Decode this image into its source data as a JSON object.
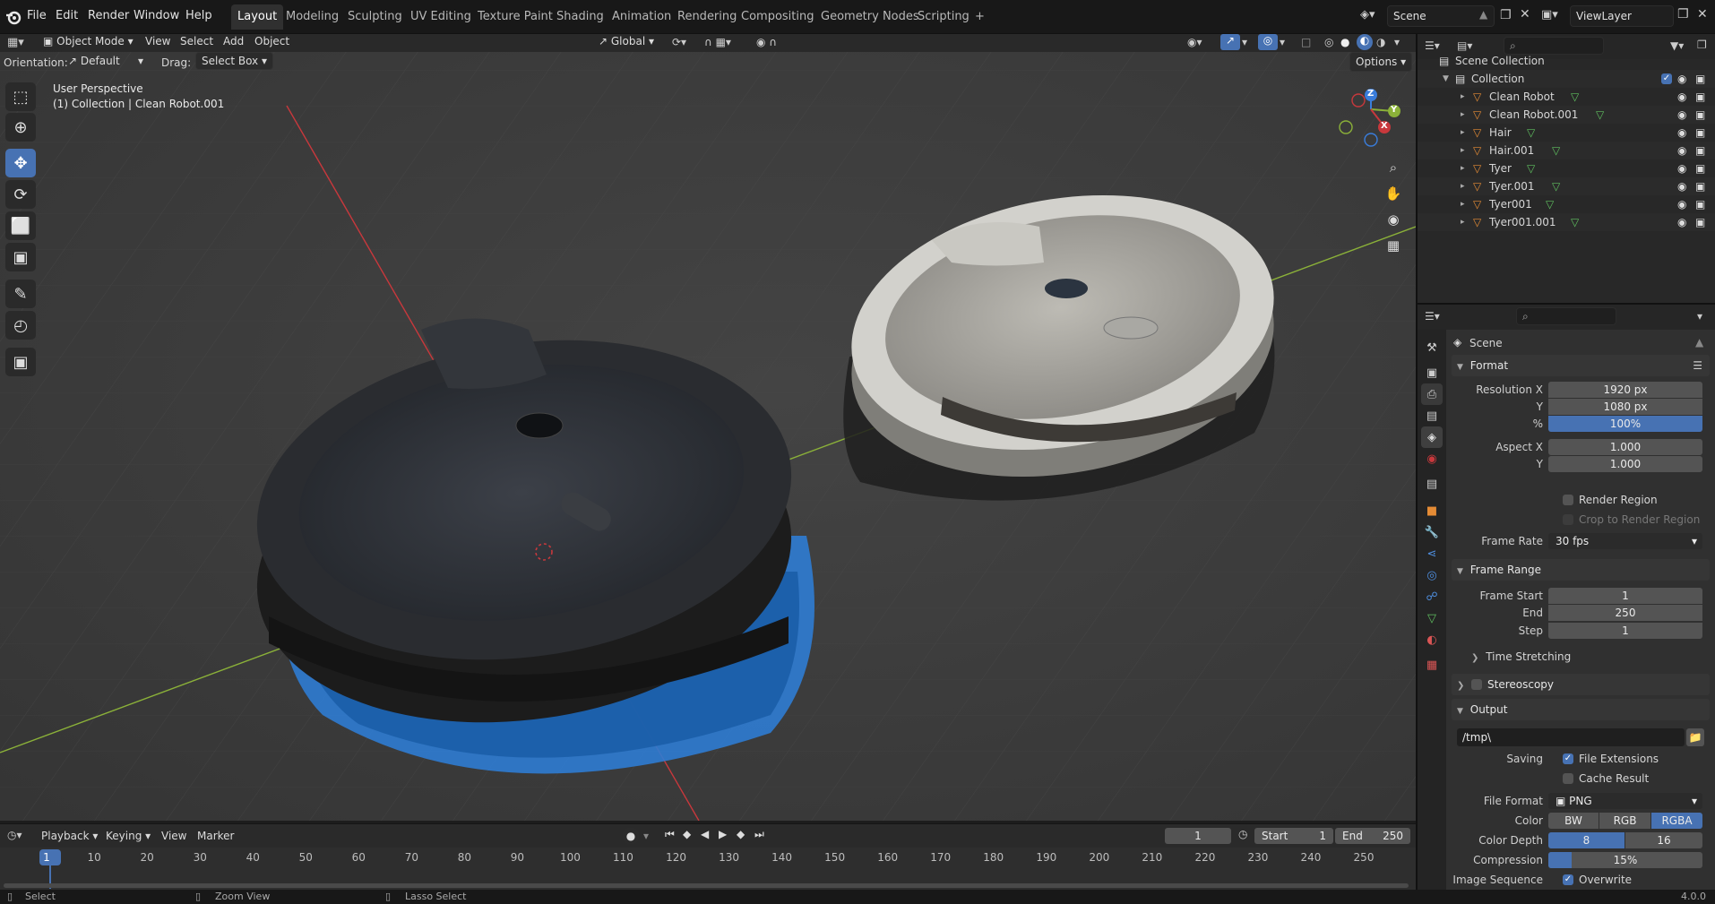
{
  "topbar": {
    "menus": [
      "File",
      "Edit",
      "Render",
      "Window",
      "Help"
    ],
    "workspaces": [
      "Layout",
      "Modeling",
      "Sculpting",
      "UV Editing",
      "Texture Paint",
      "Shading",
      "Animation",
      "Rendering",
      "Compositing",
      "Geometry Nodes",
      "Scripting"
    ],
    "active_workspace": "Layout",
    "add_workspace": "+",
    "scene": "Scene",
    "view_layer": "ViewLayer"
  },
  "viewport_header": {
    "mode": "Object Mode",
    "menus": [
      "View",
      "Select",
      "Add",
      "Object"
    ],
    "transform_orientation": "Global",
    "orientation_label": "Orientation:",
    "orientation_value": "Default",
    "drag_label": "Drag:",
    "drag_value": "Select Box",
    "options": "Options"
  },
  "viewport": {
    "view_name": "User Perspective",
    "view_context": "(1) Collection | Clean Robot.001",
    "gizmo_axes": [
      "Z",
      "Y",
      "X"
    ],
    "colors": {
      "x_axis": "#c8383c",
      "y_axis": "#8bb139",
      "z_axis": "#3a7ddb",
      "selection": "#4772b3"
    }
  },
  "tools": [
    "select-box",
    "cursor",
    "move",
    "rotate",
    "scale",
    "transform",
    "annotate",
    "measure",
    "add-cube"
  ],
  "outliner": {
    "root": "Scene Collection",
    "collection": "Collection",
    "items": [
      {
        "name": "Clean Robot"
      },
      {
        "name": "Clean Robot.001"
      },
      {
        "name": "Hair"
      },
      {
        "name": "Hair.001"
      },
      {
        "name": "Tyer"
      },
      {
        "name": "Tyer.001"
      },
      {
        "name": "Tyer001"
      },
      {
        "name": "Tyer001.001"
      }
    ]
  },
  "properties": {
    "context": "Scene",
    "format": {
      "title": "Format",
      "res_x_label": "Resolution X",
      "res_x": "1920 px",
      "res_y_label": "Y",
      "res_y": "1080 px",
      "res_pct_label": "%",
      "res_pct": "100%",
      "aspect_x_label": "Aspect X",
      "aspect_x": "1.000",
      "aspect_y_label": "Y",
      "aspect_y": "1.000",
      "render_region": "Render Region",
      "crop_region": "Crop to Render Region",
      "frame_rate_label": "Frame Rate",
      "frame_rate": "30 fps"
    },
    "frame_range": {
      "title": "Frame Range",
      "start_label": "Frame Start",
      "start": "1",
      "end_label": "End",
      "end": "250",
      "step_label": "Step",
      "step": "1",
      "time_stretching": "Time Stretching"
    },
    "stereoscopy": "Stereoscopy",
    "output": {
      "title": "Output",
      "path": "/tmp\\",
      "saving_label": "Saving",
      "file_extensions": "File Extensions",
      "cache_result": "Cache Result",
      "file_format_label": "File Format",
      "file_format": "PNG",
      "color_label": "Color",
      "color_options": [
        "BW",
        "RGB",
        "RGBA"
      ],
      "color_selected": "RGBA",
      "color_depth_label": "Color Depth",
      "color_depth_options": [
        "8",
        "16"
      ],
      "color_depth_selected": "8",
      "compression_label": "Compression",
      "compression": "15%",
      "compression_value": 0.15,
      "image_sequence_label": "Image Sequence",
      "overwrite": "Overwrite"
    }
  },
  "timeline": {
    "menus": [
      "Playback",
      "Keying",
      "View",
      "Marker"
    ],
    "current_frame": "1",
    "start_label": "Start",
    "start": "1",
    "end_label": "End",
    "end": "250",
    "ticks": [
      "1",
      "10",
      "20",
      "30",
      "40",
      "50",
      "60",
      "70",
      "80",
      "90",
      "100",
      "110",
      "120",
      "130",
      "140",
      "150",
      "160",
      "170",
      "180",
      "190",
      "200",
      "210",
      "220",
      "230",
      "240",
      "250"
    ]
  },
  "statusbar": {
    "hints": [
      "Select",
      "Zoom View",
      "Lasso Select"
    ],
    "version": "4.0.0"
  }
}
